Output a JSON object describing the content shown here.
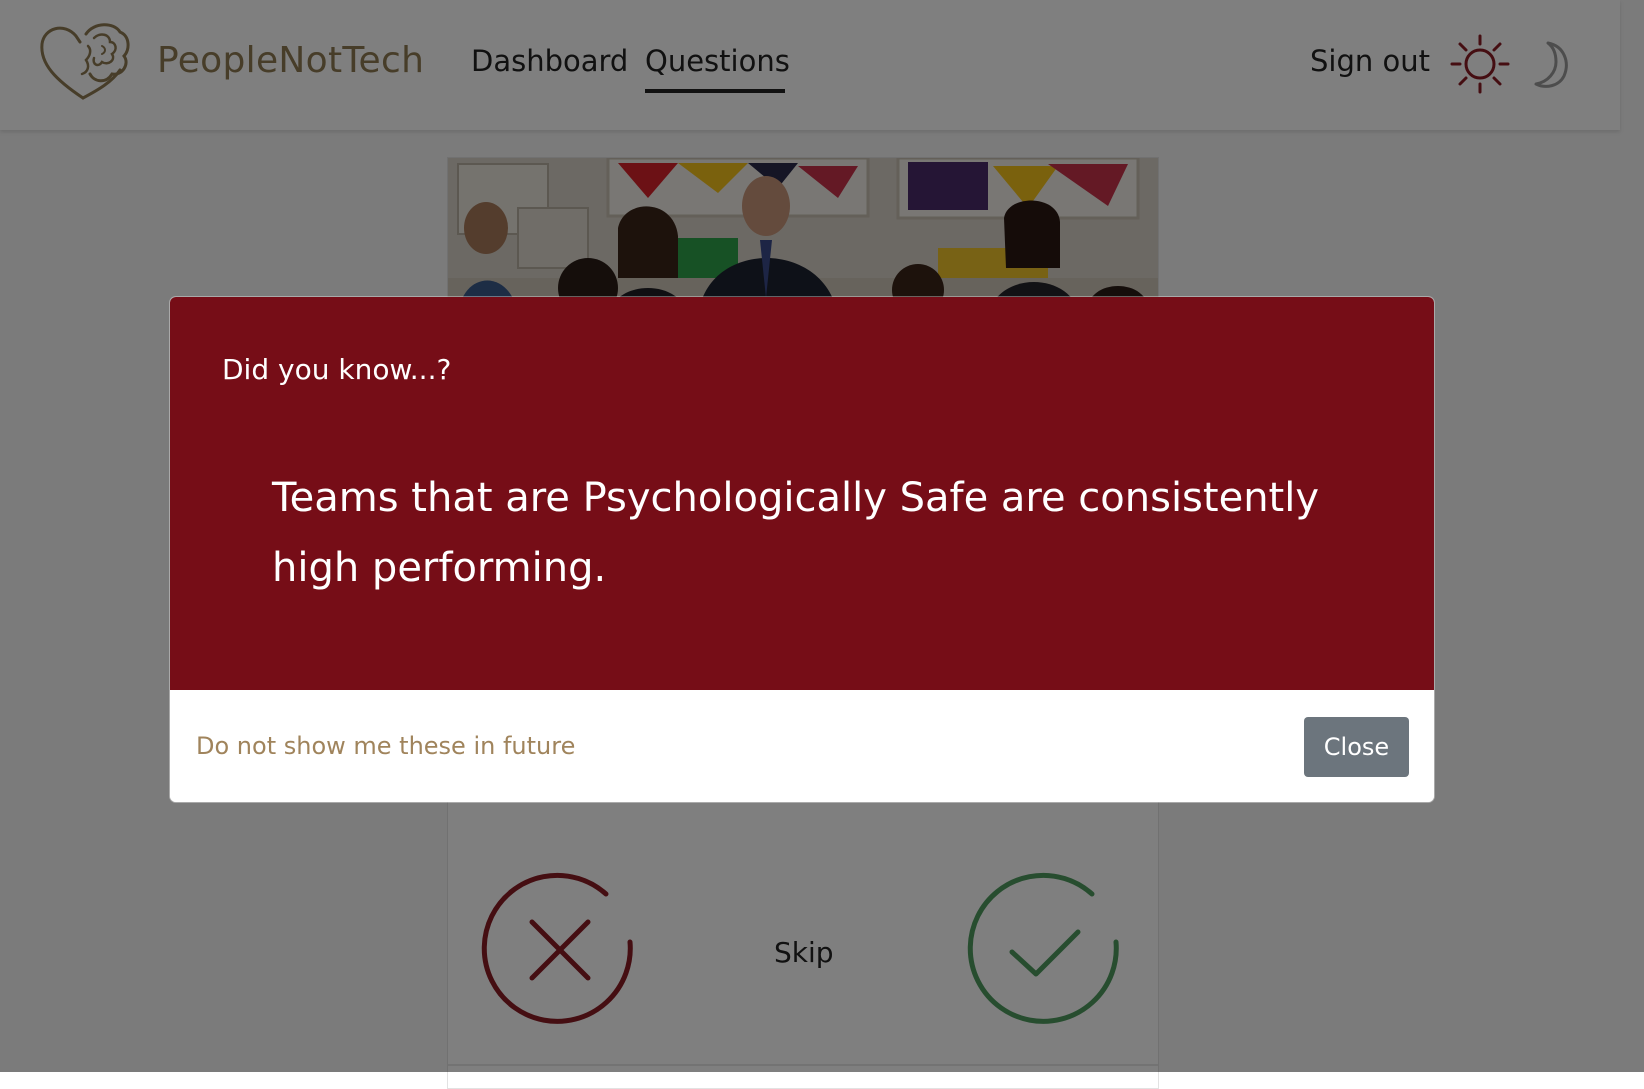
{
  "nav": {
    "brand": "PeopleNotTech",
    "links": [
      {
        "label": "Dashboard",
        "active": false
      },
      {
        "label": "Questions",
        "active": true
      }
    ],
    "sign_out": "Sign out",
    "theme_icons": [
      "sun-icon",
      "moon-icon"
    ]
  },
  "card": {
    "skip_label": "Skip",
    "no_icon": "x-circle-icon",
    "yes_icon": "check-circle-icon"
  },
  "modal": {
    "title": "Did you know...?",
    "fact": "Teams that are Psychologically Safe are consistently high performing.",
    "opt_out_link": "Do not show me these in future",
    "close_button": "Close"
  },
  "colors": {
    "brand": "#8e7a52",
    "modal_background": "#760d17",
    "close_button": "#6c757d",
    "no_answer": "#8a1c24",
    "yes_answer": "#4e9a5e"
  }
}
